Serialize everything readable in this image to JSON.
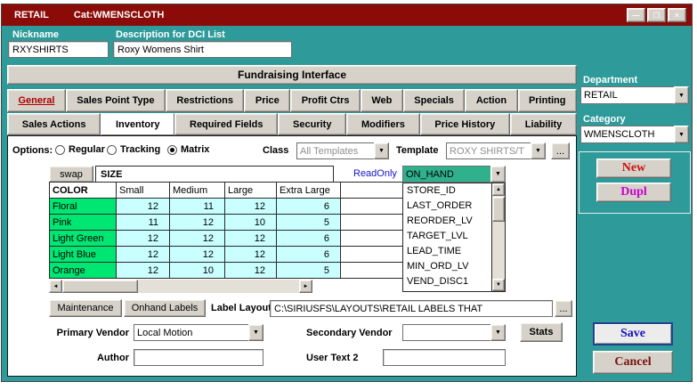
{
  "window": {
    "title": "RETAIL",
    "subtitle": "Cat:WMENSCLOTH"
  },
  "icons": {
    "minimize": "—",
    "maximize": "❐",
    "close": "✕",
    "dropdown": "▼",
    "scroll_left": "◄",
    "scroll_right": "►",
    "scroll_up": "▲",
    "scroll_down": "▼",
    "browse": "..."
  },
  "header_fields": {
    "nickname_label": "Nickname",
    "nickname_value": "RXYSHIRTS",
    "description_label": "Description for DCI List",
    "description_value": "Roxy Womens Shirt"
  },
  "fundraising_label": "Fundraising Interface",
  "tabs": {
    "row1": [
      "General",
      "Sales Point Type",
      "Restrictions",
      "Price",
      "Profit Ctrs",
      "Web",
      "Specials",
      "Action",
      "Printing"
    ],
    "row2": [
      "Sales Actions",
      "Inventory",
      "Required Fields",
      "Security",
      "Modifiers",
      "Price History",
      "Liability"
    ],
    "active_row1": "General",
    "active_row2": "Inventory"
  },
  "inventory": {
    "options_label": "Options:",
    "radios": [
      {
        "label": "Regular",
        "selected": false
      },
      {
        "label": "Tracking",
        "selected": false
      },
      {
        "label": "Matrix",
        "selected": true
      }
    ],
    "class_label": "Class",
    "class_value": "All Templates",
    "template_label": "Template",
    "template_value": "ROXY SHIRTS/T",
    "matrix": {
      "swap_label": "swap",
      "size_label": "SIZE",
      "readonly_label": "ReadOnly",
      "field_value": "ON_HAND",
      "columns": [
        "COLOR",
        "Small",
        "Medium",
        "Large",
        "Extra Large"
      ],
      "rows": [
        {
          "color": "Floral",
          "values": [
            12,
            11,
            12,
            6
          ]
        },
        {
          "color": "Pink",
          "values": [
            11,
            12,
            10,
            5
          ]
        },
        {
          "color": "Light Green",
          "values": [
            12,
            12,
            12,
            6
          ]
        },
        {
          "color": "Light Blue",
          "values": [
            12,
            12,
            12,
            6
          ]
        },
        {
          "color": "Orange",
          "values": [
            12,
            10,
            12,
            5
          ]
        }
      ]
    },
    "field_list": [
      "STORE_ID",
      "LAST_ORDER",
      "REORDER_LV",
      "TARGET_LVL",
      "LEAD_TIME",
      "MIN_ORD_LV",
      "VEND_DISC1"
    ],
    "maintenance_label": "Maintenance",
    "onhand_labels_label": "Onhand Labels",
    "label_layout_label": "Label Layout",
    "label_layout_value": "C:\\SIRIUSFS\\LAYOUTS\\RETAIL LABELS THAT",
    "primary_vendor_label": "Primary Vendor",
    "primary_vendor_value": "Local Motion",
    "secondary_vendor_label": "Secondary Vendor",
    "secondary_vendor_value": "",
    "stats_label": "Stats",
    "author_label": "Author",
    "author_value": "",
    "user_text2_label": "User Text 2",
    "user_text2_value": ""
  },
  "right_panel": {
    "department_label": "Department",
    "department_value": "RETAIL",
    "category_label": "Category",
    "category_value": "WMENSCLOTH",
    "new_label": "New",
    "dupl_label": "Dupl",
    "save_label": "Save",
    "cancel_label": "Cancel"
  },
  "colors": {
    "titlebar": "#8a0b08",
    "teal_background": "#2f9a9a",
    "matrix_color_green": "#00e673",
    "matrix_value_cyan": "#c9ffff",
    "readonly_blue": "#1414cc",
    "onhand_field_green": "#30b18e",
    "new_red": "#cc1111",
    "dupl_magenta": "#cc00cc",
    "save_blue": "#1111bb",
    "cancel_maroon": "#7a1010"
  }
}
